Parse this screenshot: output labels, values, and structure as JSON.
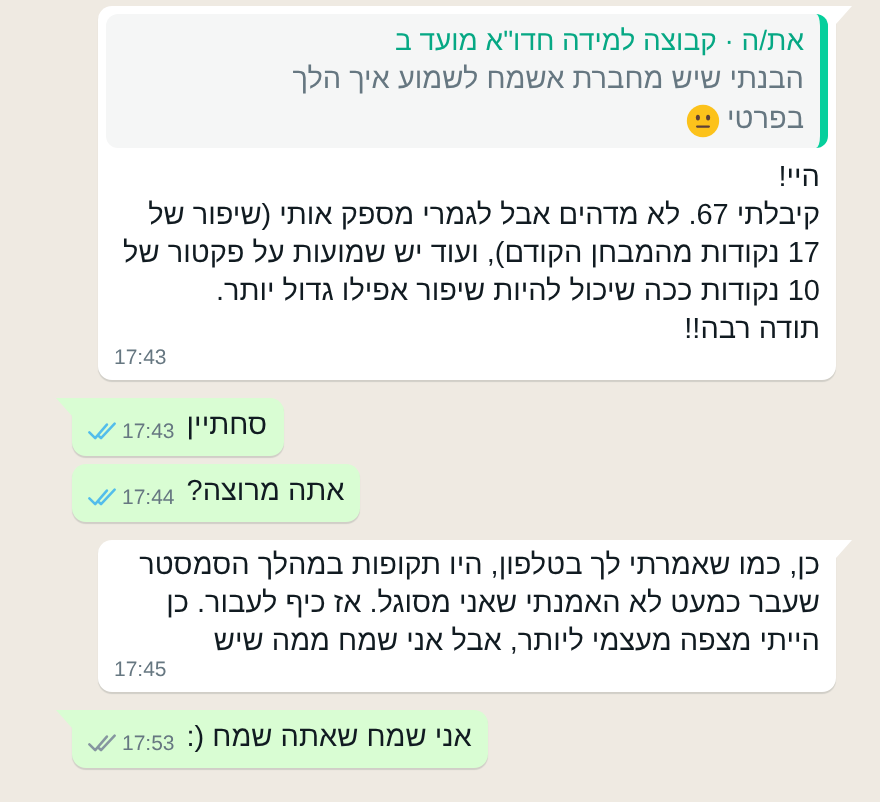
{
  "messages": [
    {
      "kind": "incoming",
      "quote": {
        "author": "את/ה · קבוצה למידה חדו\"א מועד ב",
        "lines": [
          "הבנתי שיש מחברת אשמח לשמוע איך הלך",
          "בפרטי"
        ],
        "emoji": true
      },
      "text": "היי!\nקיבלתי 67. לא מדהים אבל לגמרי מספק אותי (שיפור של 17 נקודות מהמבחן הקודם), ועוד יש שמועות על פקטור של 10 נקודות ככה שיכול להיות שיפור אפילו גדול יותר.\nתודה רבה!!",
      "time": "17:43"
    },
    {
      "kind": "outgoing",
      "text": "סחתיין",
      "time": "17:43",
      "read": true
    },
    {
      "kind": "outgoing",
      "text": "אתה מרוצה?",
      "time": "17:44",
      "read": true
    },
    {
      "kind": "incoming",
      "text": "כן, כמו שאמרתי לך בטלפון, היו תקופות במהלך הסמסטר שעבר כמעט לא האמנתי שאני מסוגל. אז כיף לעבור. כן הייתי מצפה מעצמי ליותר, אבל אני שמח ממה שיש",
      "time": "17:45"
    },
    {
      "kind": "outgoing",
      "text": "אני שמח שאתה שמח (:",
      "time": "17:53",
      "read": false
    }
  ]
}
